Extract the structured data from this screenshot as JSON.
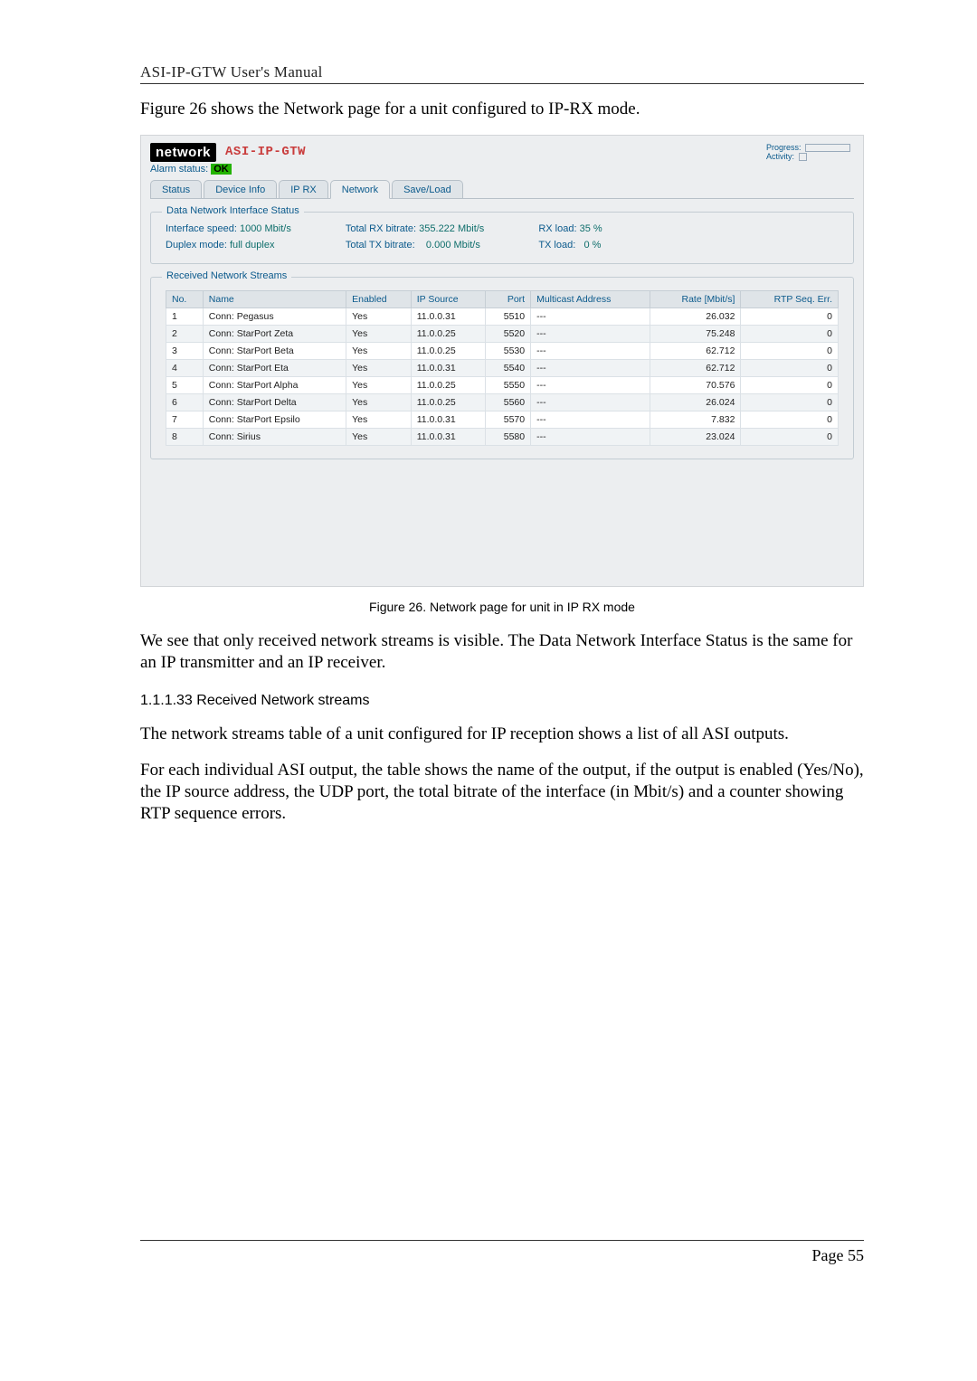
{
  "doc": {
    "header": "ASI-IP-GTW User's Manual",
    "intro": "Figure 26 shows the Network page for a unit configured to IP-RX mode.",
    "caption": "Figure 26. Network page for unit in IP RX mode",
    "para1": "We see that only received network streams is visible. The Data Network Interface Status is the same for an IP transmitter and an IP receiver.",
    "subhead": "1.1.1.33 Received Network streams",
    "para2": "The network streams table of a unit configured for IP reception shows a list of all ASI outputs.",
    "para3": "For each individual ASI output, the table shows the name of the output, if the output is enabled (Yes/No), the IP source address, the UDP port, the total bitrate of the interface (in Mbit/s) and a counter showing RTP sequence errors.",
    "footer": "Page 55"
  },
  "shot": {
    "logo_word": "network",
    "product": "ASI-IP-GTW",
    "alarm_label": "Alarm status:",
    "alarm_value": "OK",
    "progress_label": "Progress:",
    "activity_label": "Activity:",
    "tabs": [
      "Status",
      "Device Info",
      "IP RX",
      "Network",
      "Save/Load"
    ],
    "active_tab": 3,
    "iface_legend": "Data Network Interface Status",
    "iface": {
      "speed_label": "Interface speed:",
      "speed_value": "1000 Mbit/s",
      "duplex_label": "Duplex mode:",
      "duplex_value": "full duplex",
      "rx_bitrate_label": "Total RX bitrate:",
      "rx_bitrate_value": "355.222 Mbit/s",
      "tx_bitrate_label": "Total TX bitrate:",
      "tx_bitrate_value": "0.000 Mbit/s",
      "rx_load_label": "RX load:",
      "rx_load_value": "35 %",
      "tx_load_label": "TX load:",
      "tx_load_value": "0 %"
    },
    "streams_legend": "Received Network Streams",
    "columns": [
      "No.",
      "Name",
      "Enabled",
      "IP Source",
      "Port",
      "Multicast Address",
      "Rate [Mbit/s]",
      "RTP Seq. Err."
    ],
    "rows": [
      {
        "no": "1",
        "name": "Conn: Pegasus",
        "enabled": "Yes",
        "ip": "11.0.0.31",
        "port": "5510",
        "mc": "---",
        "rate": "26.032",
        "err": "0"
      },
      {
        "no": "2",
        "name": "Conn: StarPort Zeta",
        "enabled": "Yes",
        "ip": "11.0.0.25",
        "port": "5520",
        "mc": "---",
        "rate": "75.248",
        "err": "0"
      },
      {
        "no": "3",
        "name": "Conn: StarPort Beta",
        "enabled": "Yes",
        "ip": "11.0.0.25",
        "port": "5530",
        "mc": "---",
        "rate": "62.712",
        "err": "0"
      },
      {
        "no": "4",
        "name": "Conn: StarPort Eta",
        "enabled": "Yes",
        "ip": "11.0.0.31",
        "port": "5540",
        "mc": "---",
        "rate": "62.712",
        "err": "0"
      },
      {
        "no": "5",
        "name": "Conn: StarPort Alpha",
        "enabled": "Yes",
        "ip": "11.0.0.25",
        "port": "5550",
        "mc": "---",
        "rate": "70.576",
        "err": "0"
      },
      {
        "no": "6",
        "name": "Conn: StarPort Delta",
        "enabled": "Yes",
        "ip": "11.0.0.25",
        "port": "5560",
        "mc": "---",
        "rate": "26.024",
        "err": "0"
      },
      {
        "no": "7",
        "name": "Conn: StarPort Epsilo",
        "enabled": "Yes",
        "ip": "11.0.0.31",
        "port": "5570",
        "mc": "---",
        "rate": "7.832",
        "err": "0"
      },
      {
        "no": "8",
        "name": "Conn: Sirius",
        "enabled": "Yes",
        "ip": "11.0.0.31",
        "port": "5580",
        "mc": "---",
        "rate": "23.024",
        "err": "0"
      }
    ]
  }
}
